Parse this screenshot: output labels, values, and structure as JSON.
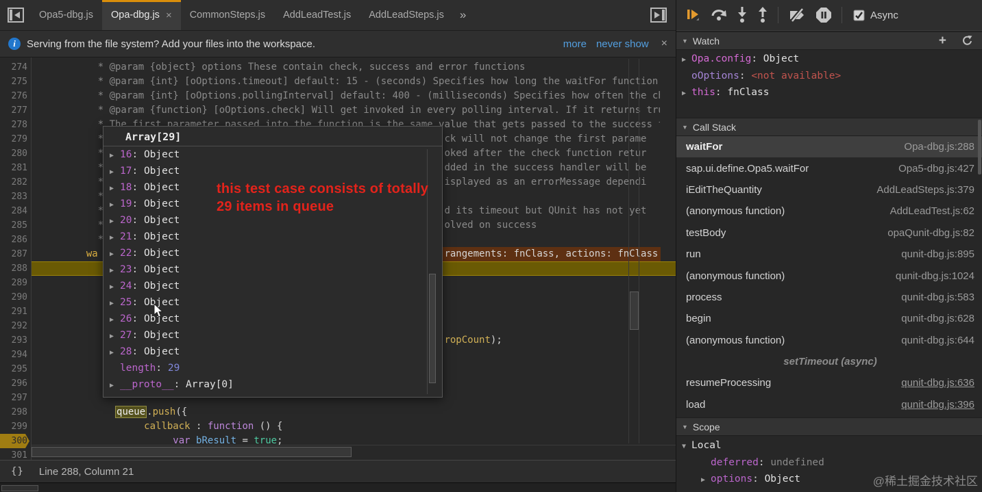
{
  "icons": {
    "collapse": "▼",
    "expand": "▶",
    "overflow": "»",
    "close": "×",
    "add": "+",
    "info": "i",
    "pretty_print": "{}"
  },
  "tabbar": {
    "tabs": [
      {
        "label": "Opa5-dbg.js",
        "active": false
      },
      {
        "label": "Opa-dbg.js",
        "active": true,
        "close": "×"
      },
      {
        "label": "CommonSteps.js",
        "active": false
      },
      {
        "label": "AddLeadTest.js",
        "active": false
      },
      {
        "label": "AddLeadSteps.js",
        "active": false
      }
    ],
    "overflow": "»"
  },
  "infobar": {
    "message": "Serving from the file system? Add your files into the workspace.",
    "link_more": "more",
    "link_never": "never show",
    "close": "×"
  },
  "editor": {
    "lines": [
      {
        "num": "274",
        "segs": [
          {
            "t": "           * @param {object} options These contain check, success and error functions",
            "c": "com"
          }
        ]
      },
      {
        "num": "275",
        "segs": [
          {
            "t": "           * @param {int} [oOptions.timeout] default: 15 - (seconds) Specifies how long the waitFor function polls before it fails",
            "c": "com"
          }
        ]
      },
      {
        "num": "276",
        "segs": [
          {
            "t": "           * @param {int} [oOptions.pollingInterval] default: 400 - (milliseconds) Specifies how often the check function is executed",
            "c": "com"
          }
        ]
      },
      {
        "num": "277",
        "segs": [
          {
            "t": "           * @param {function} [oOptions.check] Will get invoked in every polling interval. If it returns true the check is successful",
            "c": "com"
          }
        ]
      },
      {
        "num": "278",
        "segs": [
          {
            "t": "           * The first parameter passed into the function is the same value that gets passed to the success function",
            "c": "com"
          }
        ]
      },
      {
        "num": "279",
        "segs": [
          {
            "t": "           *                                                           ck will not change the first parame",
            "c": "com"
          }
        ]
      },
      {
        "num": "280",
        "segs": [
          {
            "t": "           *                                                           oked after the check function retur",
            "c": "com"
          }
        ]
      },
      {
        "num": "281",
        "segs": [
          {
            "t": "           *                                                           dded in the success handler will be",
            "c": "com"
          }
        ]
      },
      {
        "num": "282",
        "segs": [
          {
            "t": "           *                                                           isplayed as an errorMessage dependi",
            "c": "com"
          }
        ]
      },
      {
        "num": "283",
        "segs": [
          {
            "t": "           *",
            "c": "com"
          }
        ]
      },
      {
        "num": "284",
        "segs": [
          {
            "t": "           *                                                           d its timeout but QUnit has not yet",
            "c": "com"
          }
        ]
      },
      {
        "num": "285",
        "segs": [
          {
            "t": "           *                                                           olved on success",
            "c": "com"
          }
        ]
      },
      {
        "num": "286",
        "segs": [
          {
            "t": "           *",
            "c": "com"
          }
        ]
      },
      {
        "num": "287",
        "hl": "brown",
        "segs": [
          {
            "t": "         ",
            "c": "plain"
          },
          {
            "t": "wa",
            "c": "goldtext"
          },
          {
            "t": "                                                            ",
            "c": "plain"
          },
          {
            "t": "rangements: fnClass, actions: fnClass",
            "c": "plain"
          }
        ]
      },
      {
        "num": "288",
        "hl": "exec",
        "segs": []
      },
      {
        "num": "289",
        "segs": []
      },
      {
        "num": "290",
        "segs": []
      },
      {
        "num": "291",
        "segs": []
      },
      {
        "num": "292",
        "segs": []
      },
      {
        "num": "293",
        "segs": [
          {
            "t": "                                                                       ",
            "c": "plain"
          },
          {
            "t": "ropCount",
            "c": "gold"
          },
          {
            "t": ");",
            "c": "plain"
          }
        ]
      },
      {
        "num": "294",
        "segs": []
      },
      {
        "num": "295",
        "segs": []
      },
      {
        "num": "296",
        "segs": []
      },
      {
        "num": "297",
        "segs": []
      },
      {
        "num": "298",
        "segs": [
          {
            "t": "              ",
            "c": "plain"
          },
          {
            "t": "queue",
            "c": "boxed"
          },
          {
            "t": ".",
            "c": "plain"
          },
          {
            "t": "push",
            "c": "gold"
          },
          {
            "t": "({",
            "c": "plain"
          }
        ]
      },
      {
        "num": "299",
        "segs": [
          {
            "t": "                   ",
            "c": "plain"
          },
          {
            "t": "callback ",
            "c": "gold"
          },
          {
            "t": ": ",
            "c": "plain"
          },
          {
            "t": "function",
            "c": "kw"
          },
          {
            "t": " () {",
            "c": "plain"
          }
        ]
      },
      {
        "num": "300",
        "marker": "breakpoint",
        "segs": [
          {
            "t": "                        ",
            "c": "plain"
          },
          {
            "t": "var",
            "c": "kw"
          },
          {
            "t": " ",
            "c": "plain"
          },
          {
            "t": "bResult",
            "c": "var"
          },
          {
            "t": " = ",
            "c": "plain"
          },
          {
            "t": "true",
            "c": "bool"
          },
          {
            "t": ";",
            "c": "plain"
          }
        ]
      },
      {
        "num": "301",
        "segs": []
      }
    ]
  },
  "popup": {
    "title": "Array[29]",
    "items": [
      {
        "key": "16",
        "value": "Object",
        "arrow": true
      },
      {
        "key": "17",
        "value": "Object",
        "arrow": true
      },
      {
        "key": "18",
        "value": "Object",
        "arrow": true
      },
      {
        "key": "19",
        "value": "Object",
        "arrow": true
      },
      {
        "key": "20",
        "value": "Object",
        "arrow": true
      },
      {
        "key": "21",
        "value": "Object",
        "arrow": true
      },
      {
        "key": "22",
        "value": "Object",
        "arrow": true
      },
      {
        "key": "23",
        "value": "Object",
        "arrow": true
      },
      {
        "key": "24",
        "value": "Object",
        "arrow": true
      },
      {
        "key": "25",
        "value": "Object",
        "arrow": true
      },
      {
        "key": "26",
        "value": "Object",
        "arrow": true
      },
      {
        "key": "27",
        "value": "Object",
        "arrow": true
      },
      {
        "key": "28",
        "value": "Object",
        "arrow": true
      },
      {
        "key": "length",
        "value": "29",
        "arrow": false,
        "valnum": true
      },
      {
        "key": "__proto__",
        "value": "Array[0]",
        "arrow": true
      }
    ]
  },
  "annotation": {
    "line1": "this test case consists of totally",
    "line2": "29 items in queue"
  },
  "debug_toolbar": {
    "buttons": [
      "resume-script-execution",
      "step-over",
      "step-into",
      "step-out",
      "deactivate-breakpoints",
      "pause-on-exceptions"
    ],
    "async_label": "Async",
    "async_checked": true
  },
  "watch": {
    "title": "Watch",
    "items": [
      {
        "name": "Opa.config",
        "value": "Object",
        "arrow": true,
        "nameStyle": "magenta"
      },
      {
        "name": "oOptions",
        "value": "<not available>",
        "arrow": false,
        "nameStyle": "violet",
        "valStyle": "na"
      },
      {
        "name": "this",
        "value": "fnClass",
        "arrow": true,
        "nameStyle": "magenta"
      }
    ]
  },
  "callstack": {
    "title": "Call Stack",
    "frames": [
      {
        "fn": "waitFor",
        "file": "Opa-dbg.js:288",
        "active": true
      },
      {
        "fn": "sap.ui.define.Opa5.waitFor",
        "file": "Opa5-dbg.js:427"
      },
      {
        "fn": "iEditTheQuantity",
        "file": "AddLeadSteps.js:379"
      },
      {
        "fn": "(anonymous function)",
        "file": "AddLeadTest.js:62"
      },
      {
        "fn": "testBody",
        "file": "opaQunit-dbg.js:82"
      },
      {
        "fn": "run",
        "file": "qunit-dbg.js:895"
      },
      {
        "fn": "(anonymous function)",
        "file": "qunit-dbg.js:1024"
      },
      {
        "fn": "process",
        "file": "qunit-dbg.js:583"
      },
      {
        "fn": "begin",
        "file": "qunit-dbg.js:628"
      },
      {
        "fn": "(anonymous function)",
        "file": "qunit-dbg.js:644"
      },
      {
        "separator": "setTimeout (async)"
      },
      {
        "fn": "resumeProcessing",
        "file": "qunit-dbg.js:636",
        "link": true
      },
      {
        "fn": "load",
        "file": "qunit-dbg.js:396",
        "link": true
      }
    ]
  },
  "scope": {
    "title": "Scope",
    "section": "Local",
    "vars": [
      {
        "name": "deferred",
        "value": "undefined",
        "arrow": false,
        "valStyle": "muted"
      },
      {
        "name": "options",
        "value": "Object",
        "arrow": true
      }
    ]
  },
  "statusbar": {
    "pretty_print": "{}",
    "position": "Line 288, Column 21"
  },
  "watermark": "@稀土掘金技术社区"
}
